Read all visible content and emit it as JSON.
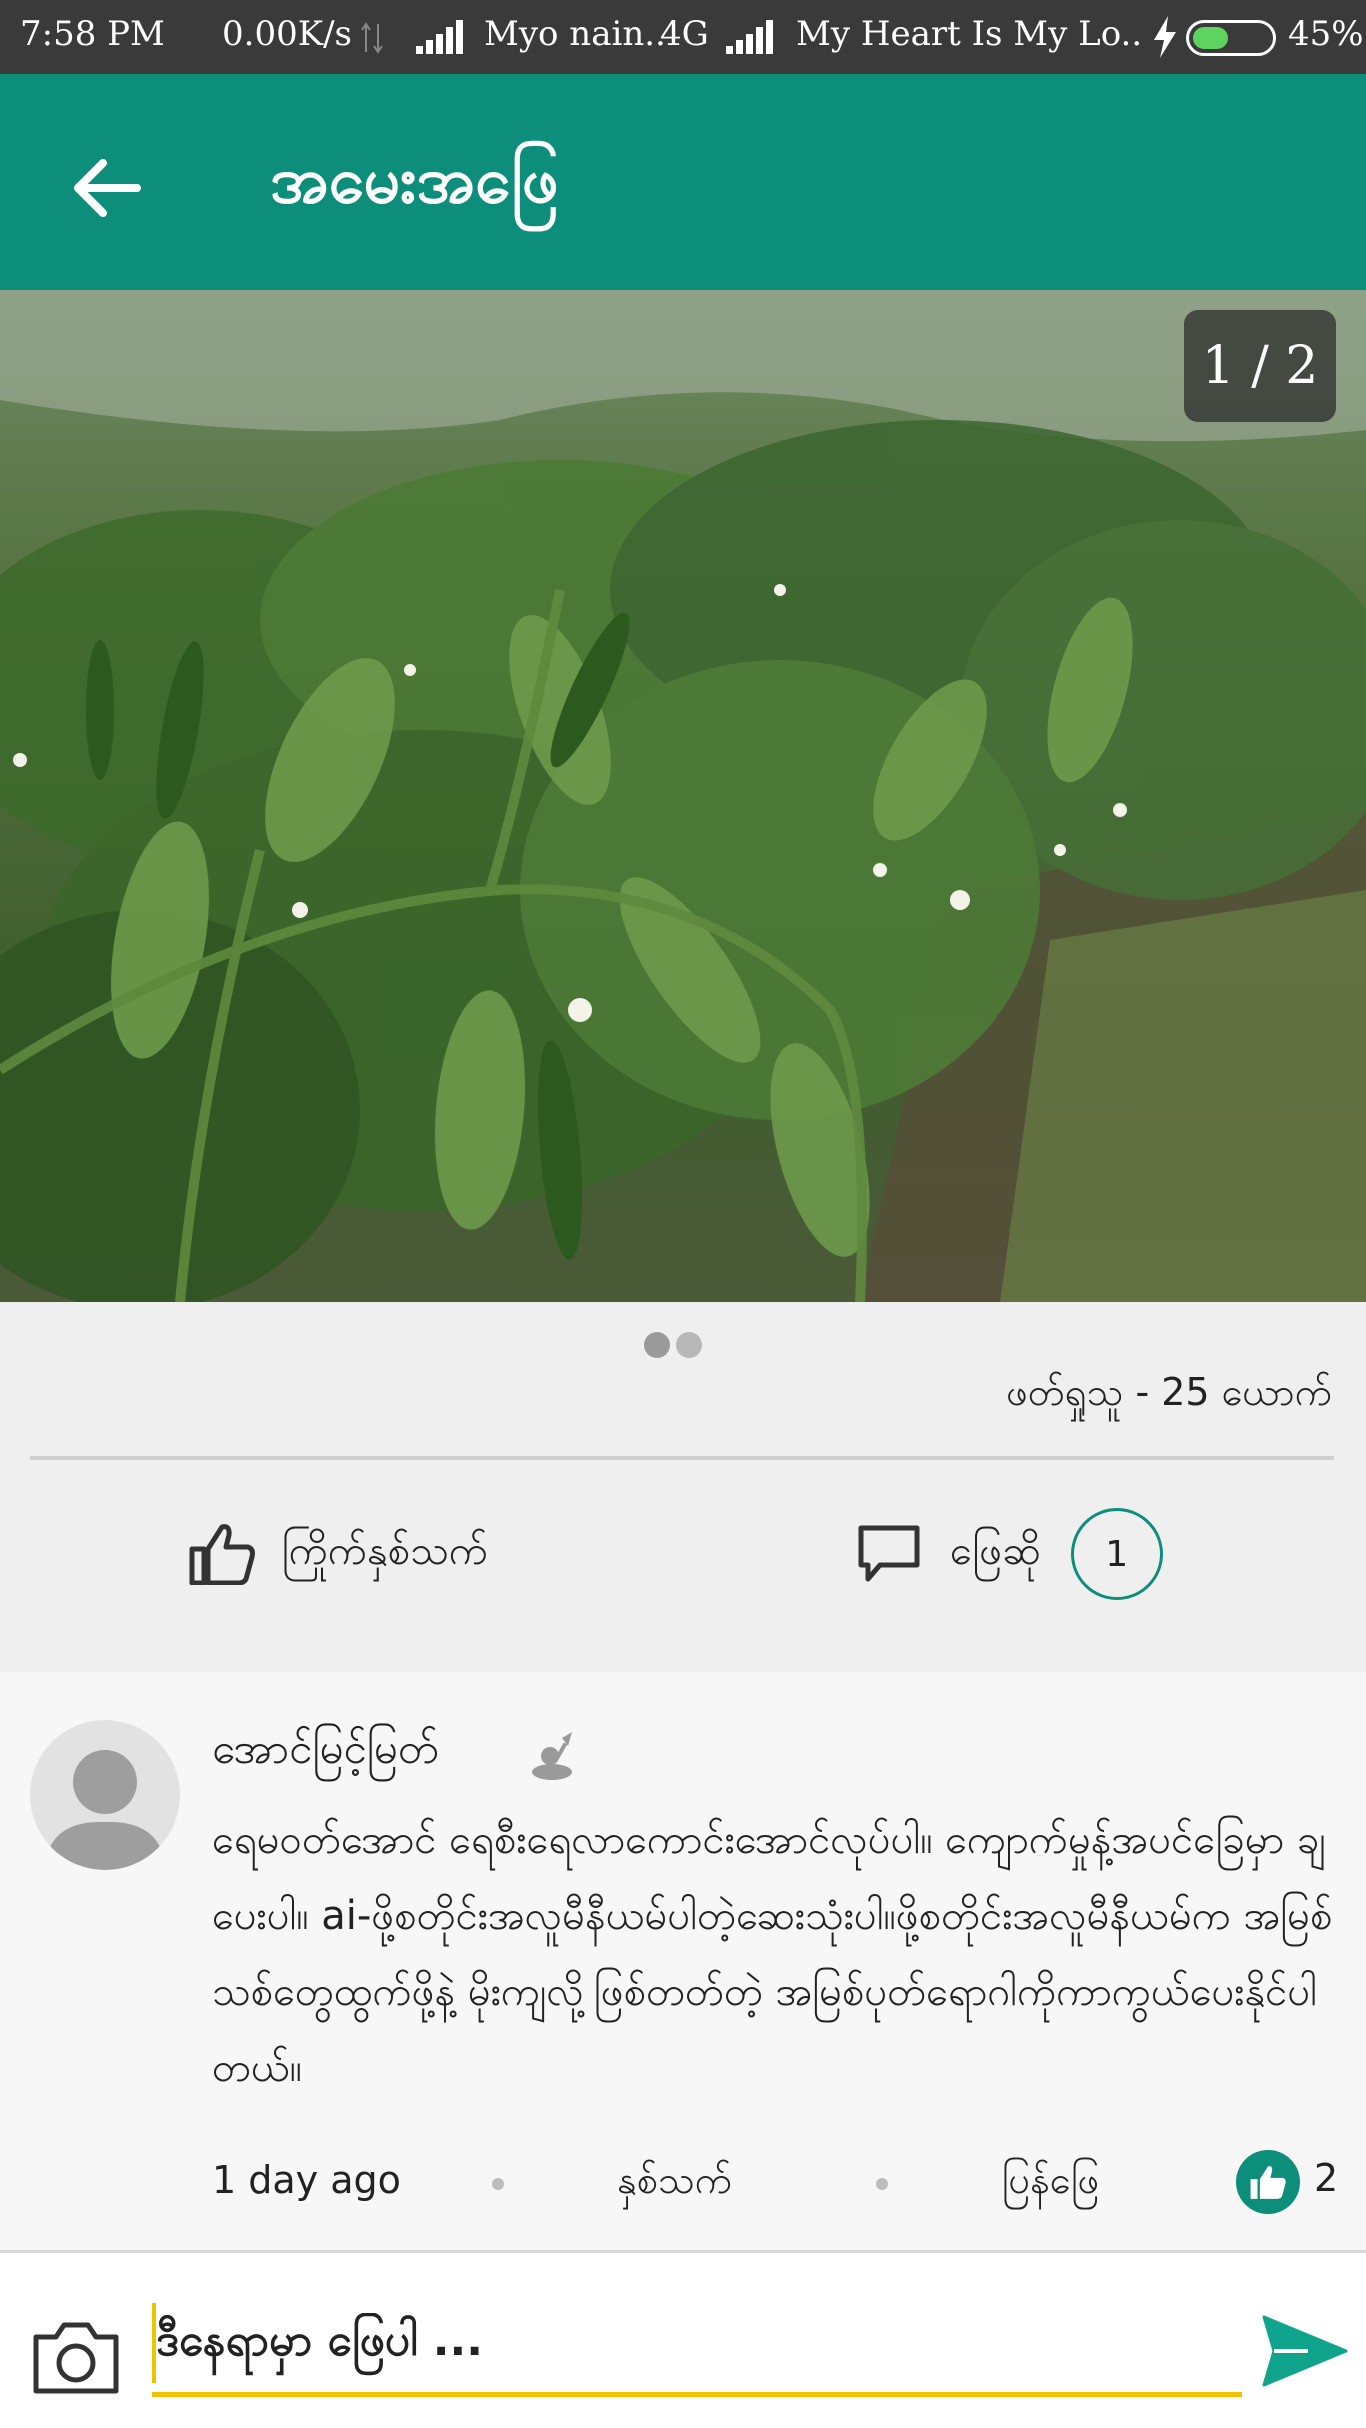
{
  "status_bar": {
    "time": "7:58 PM",
    "speed": "0.00K/s",
    "carrier1": "Myo nain..",
    "network": "4G",
    "carrier2": "My Heart Is My Lo..",
    "battery": "45%",
    "battery_level": 0.45
  },
  "app_bar": {
    "back_icon": "arrow-left-icon",
    "title": "အမေးအဖြေ"
  },
  "photo": {
    "counter": "1 / 2",
    "alt": "chili pepper plants in field"
  },
  "post": {
    "carousel_dots": 2,
    "active_dot": 1,
    "viewers": "ဖတ်ရှုသူ - 25 ယောက်",
    "like_label": "ကြိုက်နှစ်သက်",
    "comment_label": "ဖြေဆို",
    "comment_count": "1"
  },
  "comment": {
    "author": "အောင်မြင့်မြတ်",
    "body": "ရေမဝတ်အောင် ရေစီးရေလာကောင်းအောင်လုပ်ပါ။ ကျောက်မှုန့်အပင်ခြေမှာ ချပေးပါ။ ai-ဖို့စတိုင်းအလူမီနီယမ်ပါတဲ့ဆေးသုံးပါ။ဖို့စတိုင်းအလူမီနီယမ်က အမြစ်သစ်တွေထွက်ဖို့နဲ့ မိုးကျလို့ဖြစ်တတ်တဲ့ အမြစ်ပုတ်ရောဂါကိုကာကွယ်ပေးနိုင်ပါတယ်။",
    "time": "1 day ago",
    "like_label": "နှစ်သက်",
    "reply_label": "ပြန်ဖြေ",
    "like_count": "2"
  },
  "input": {
    "placeholder": "ဒီနေရာမှာ ဖြေပါ ..."
  },
  "colors": {
    "primary": "#0c8e7a",
    "accent": "#f2c200",
    "send": "#11a48c"
  }
}
